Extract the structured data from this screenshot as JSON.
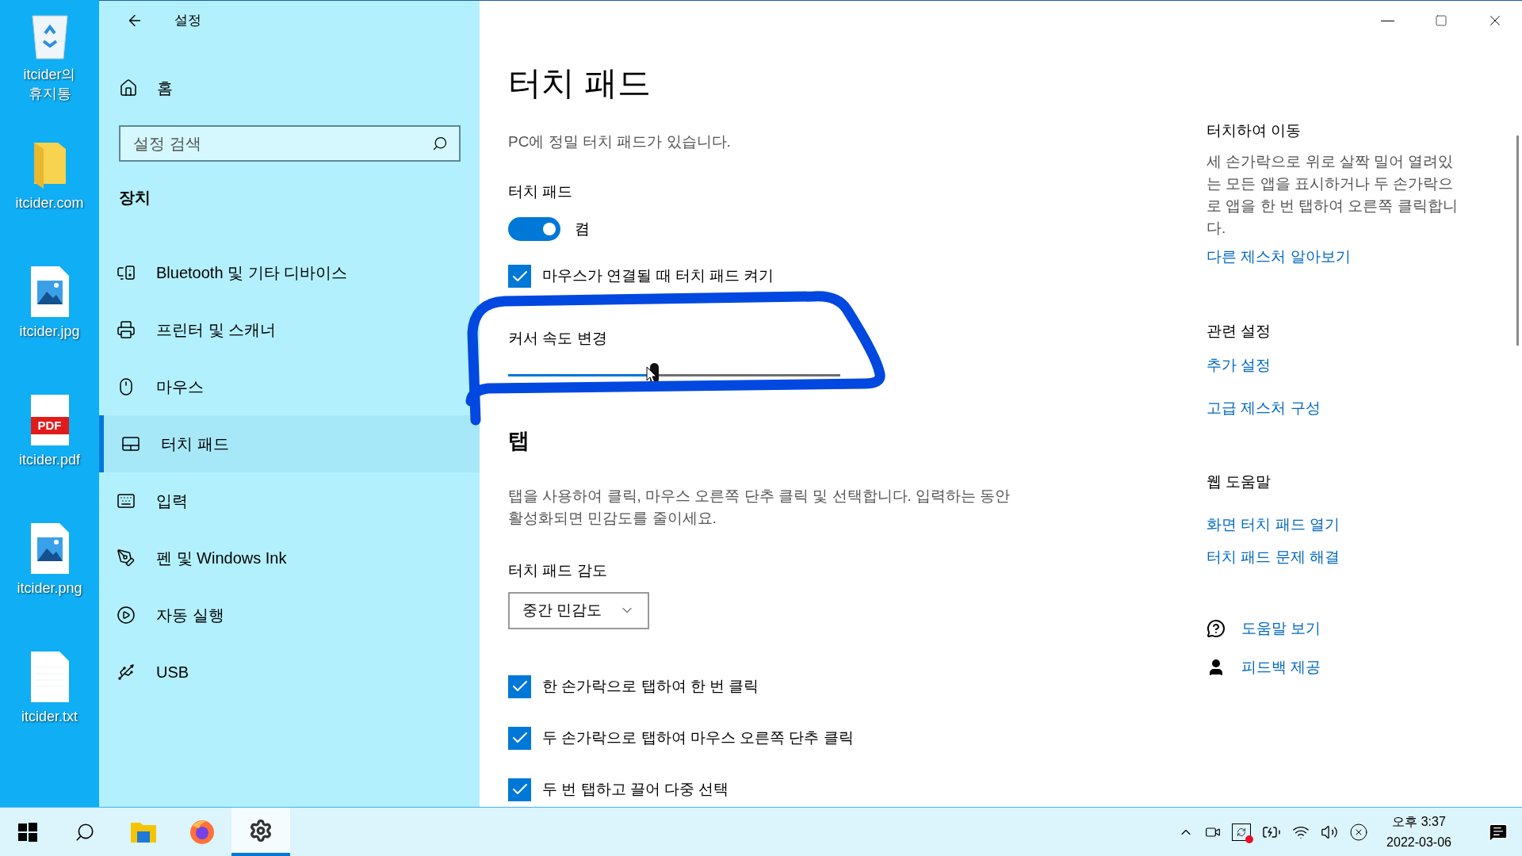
{
  "desktop_icons": [
    {
      "kind": "recycle",
      "label": "itcider의 휴지통"
    },
    {
      "kind": "folder",
      "label": "itcider.com"
    },
    {
      "kind": "image",
      "label": "itcider.jpg"
    },
    {
      "kind": "pdf",
      "label": "itcider.pdf",
      "badge": "PDF"
    },
    {
      "kind": "image",
      "label": "itcider.png"
    },
    {
      "kind": "text",
      "label": "itcider.txt"
    }
  ],
  "window": {
    "title": "설정"
  },
  "sidebar": {
    "home": "홈",
    "search": {
      "placeholder": "설정 검색"
    },
    "section": "장치",
    "items": [
      {
        "label": "Bluetooth 및 기타 디바이스",
        "selected": false
      },
      {
        "label": "프린터 및 스캐너",
        "selected": false
      },
      {
        "label": "마우스",
        "selected": false
      },
      {
        "label": "터치 패드",
        "selected": true
      },
      {
        "label": "입력",
        "selected": false
      },
      {
        "label": "펜 및 Windows Ink",
        "selected": false
      },
      {
        "label": "자동 실행",
        "selected": false
      },
      {
        "label": "USB",
        "selected": false
      }
    ]
  },
  "page": {
    "title": "터치 패드",
    "subtitle": "PC에 정밀 터치 패드가 있습니다.",
    "toggle": {
      "label": "터치 패드",
      "on": true,
      "state_text": "켬"
    },
    "mouse_checkbox": {
      "label": "마우스가 연결될 때 터치 패드 켜기",
      "checked": true
    },
    "cursor_speed": {
      "label": "커서 속도 변경",
      "level": 0.44
    },
    "tap": {
      "heading": "탭",
      "description": "탭을 사용하여 클릭, 마우스 오른쪽 단추 클릭 및 선택합니다. 입력하는 동안 활성화되면 민감도를 줄이세요.",
      "sensitivity_label": "터치 패드 감도",
      "sensitivity_value": "중간 민감도",
      "checkboxes": [
        {
          "label": "한 손가락으로 탭하여 한 번 클릭",
          "checked": true
        },
        {
          "label": "두 손가락으로 탭하여 마우스 오른쪽 단추 클릭",
          "checked": true
        },
        {
          "label": "두 번 탭하고 끌어 다중 선택",
          "checked": true
        }
      ]
    }
  },
  "right": {
    "gesture_heading": "터치하여 이동",
    "gesture_text": "세 손가락으로 위로 살짝 밀어 열려있는 모든 앱을 표시하거나 두 손가락으로 앱을 한 번 탭하여 오른쪽 클릭합니다.",
    "gesture_link": "다른 제스처 알아보기",
    "related_heading": "관련 설정",
    "related_links": [
      "추가 설정",
      "고급 제스처 구성"
    ],
    "web_heading": "웹 도움말",
    "web_links": [
      "화면 터치 패드 열기",
      "터치 패드 문제 해결"
    ],
    "help_links": [
      "도움말 보기",
      "피드백 제공"
    ]
  },
  "taskbar": {
    "apps": [
      {
        "selected": false
      },
      {
        "selected": false
      },
      {
        "selected": true
      }
    ],
    "time": "오후 3:37",
    "date": "2022-03-06"
  }
}
